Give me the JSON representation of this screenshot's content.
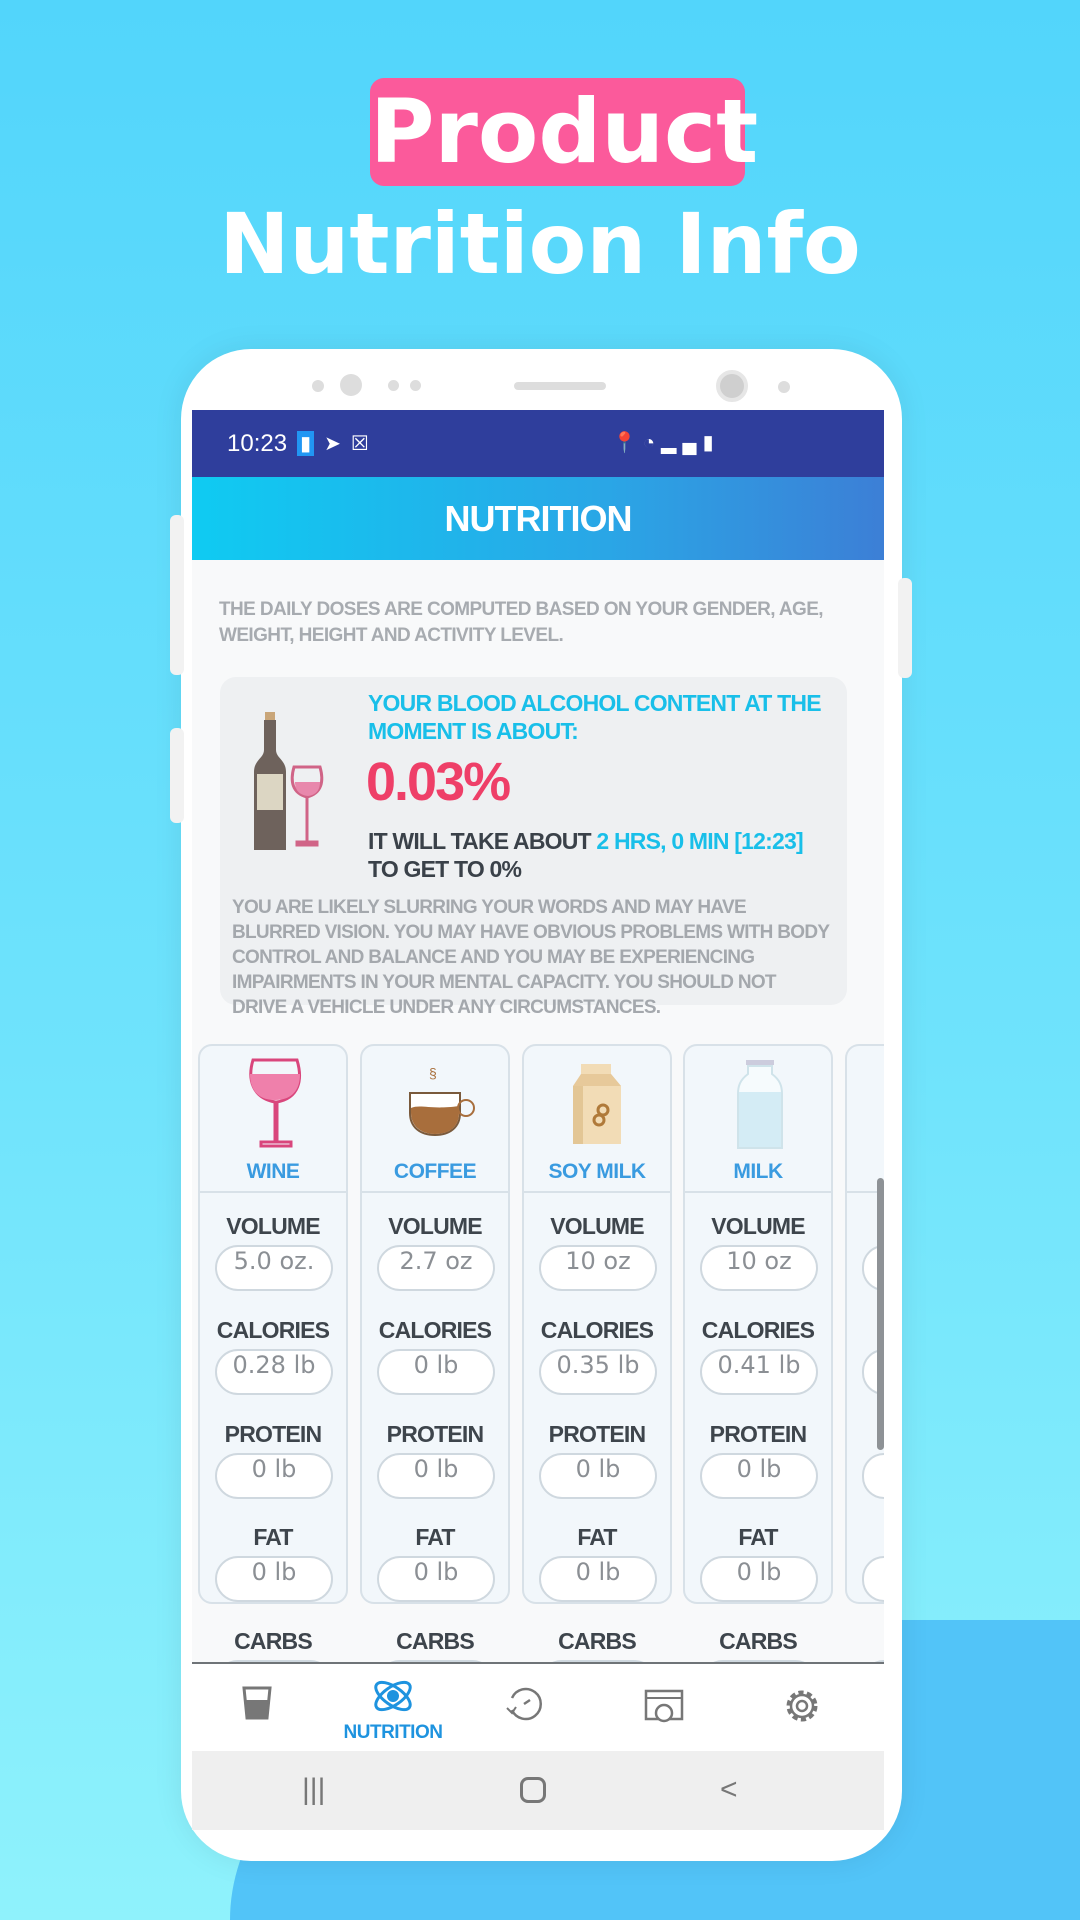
{
  "promo": {
    "highlight": "Product",
    "subtitle": "Nutrition Info",
    "highlight_color": "#fb5a9b"
  },
  "status_bar": {
    "time": "10:23"
  },
  "header": {
    "title": "NUTRITION"
  },
  "intro": "THE DAILY DOSES ARE COMPUTED BASED ON YOUR GENDER, AGE, WEIGHT, HEIGHT AND ACTIVITY LEVEL.",
  "bac": {
    "heading": "YOUR BLOOD ALCOHOL CONTENT AT THE MOMENT IS ABOUT:",
    "value": "0.03%",
    "time_prefix": "IT WILL TAKE ABOUT ",
    "time_value": "2 HRS, 0 MIN [12:23]",
    "time_suffix": " TO GET TO 0%",
    "warning": "YOU ARE LIKELY SLURRING YOUR WORDS AND MAY HAVE BLURRED VISION. YOU MAY HAVE OBVIOUS PROBLEMS WITH BODY CONTROL AND BALANCE AND YOU MAY BE EXPERIENCING IMPAIRMENTS IN YOUR MENTAL CAPACITY. YOU SHOULD NOT DRIVE A VEHICLE UNDER ANY CIRCUMSTANCES.",
    "value_color": "#ee3f68",
    "accent_color": "#19bfe9"
  },
  "field_labels": [
    "VOLUME",
    "CALORIES",
    "PROTEIN",
    "FAT",
    "CARBS"
  ],
  "drinks": [
    {
      "name": "WINE",
      "icon": "wine-glass-icon",
      "values": [
        "5.0 oz.",
        "0.28 lb",
        "0 lb",
        "0 lb"
      ]
    },
    {
      "name": "COFFEE",
      "icon": "coffee-cup-icon",
      "values": [
        "2.7 oz",
        "0 lb",
        "0 lb",
        "0 lb"
      ]
    },
    {
      "name": "SOY MILK",
      "icon": "soy-milk-carton-icon",
      "values": [
        "10 oz",
        "0.35 lb",
        "0 lb",
        "0 lb"
      ]
    },
    {
      "name": "MILK",
      "icon": "milk-bottle-icon",
      "values": [
        "10 oz",
        "0.41 lb",
        "0 lb",
        "0 lb"
      ]
    }
  ],
  "bottom_nav": [
    {
      "icon": "glass-icon",
      "label": ""
    },
    {
      "icon": "atom-icon",
      "label": "NUTRITION",
      "active": true
    },
    {
      "icon": "history-icon",
      "label": ""
    },
    {
      "icon": "calendar-clock-icon",
      "label": ""
    },
    {
      "icon": "gear-icon",
      "label": ""
    }
  ]
}
